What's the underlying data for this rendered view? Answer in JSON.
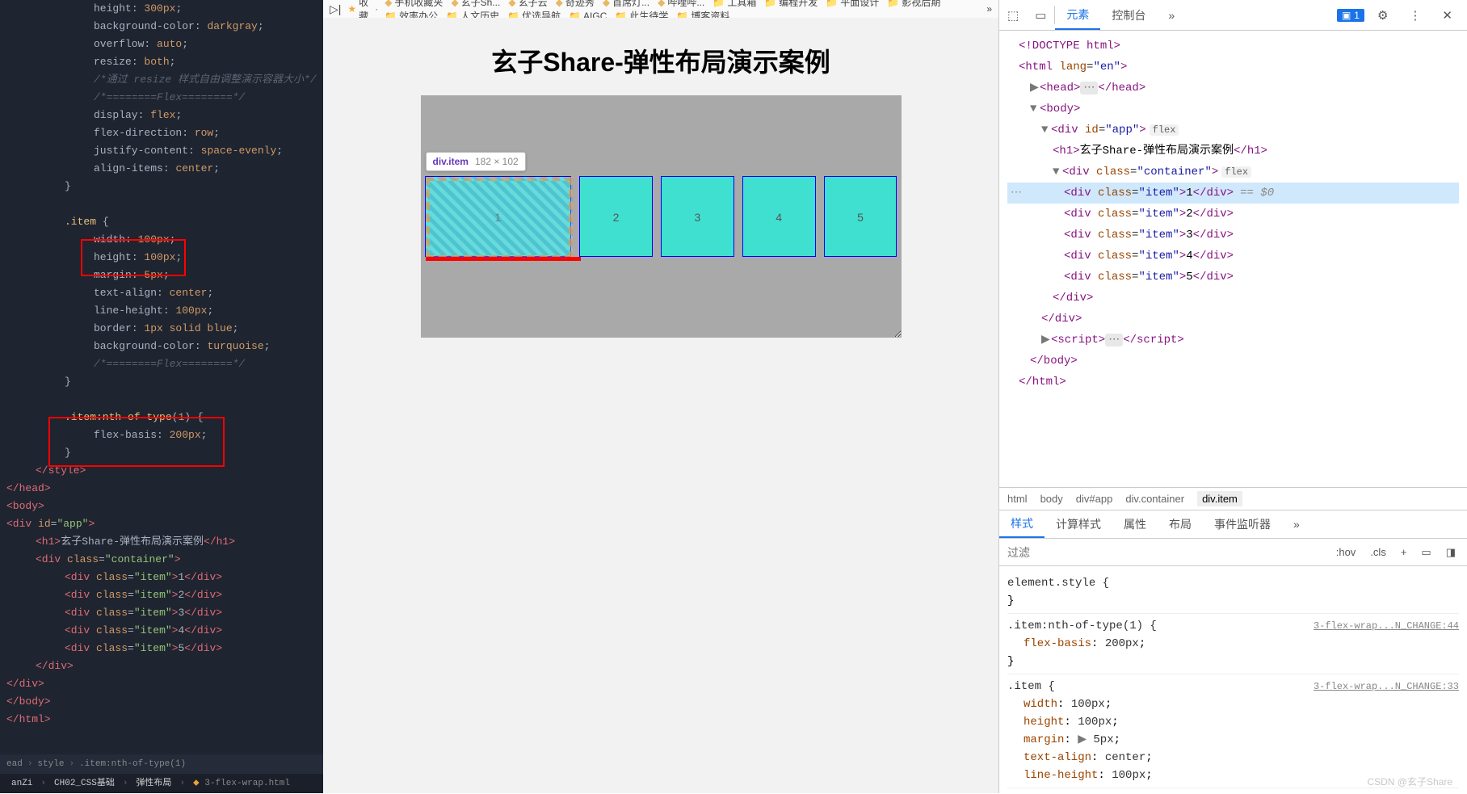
{
  "editor": {
    "lines": [
      {
        "cls": "indent3",
        "html": "<span class='tok-prop'>height</span><span class='tok-punc'>: </span><span class='tok-val'>300px</span><span class='tok-punc'>;</span>"
      },
      {
        "cls": "indent3",
        "html": "<span class='tok-prop'>background-color</span><span class='tok-punc'>: </span><span class='tok-val'>darkgray</span><span class='tok-punc'>;</span>"
      },
      {
        "cls": "indent3",
        "html": "<span class='tok-prop'>overflow</span><span class='tok-punc'>: </span><span class='tok-val'>auto</span><span class='tok-punc'>;</span>"
      },
      {
        "cls": "indent3",
        "html": "<span class='tok-prop'>resize</span><span class='tok-punc'>: </span><span class='tok-val'>both</span><span class='tok-punc'>;</span>"
      },
      {
        "cls": "indent3",
        "html": "<span class='tok-comment'>/*通过 resize 样式自由调整演示容器大小*/</span>"
      },
      {
        "cls": "indent3",
        "html": "<span class='tok-comment'>/*========Flex========*/</span>"
      },
      {
        "cls": "indent3",
        "html": "<span class='tok-prop'>display</span><span class='tok-punc'>: </span><span class='tok-val'>flex</span><span class='tok-punc'>;</span>"
      },
      {
        "cls": "indent3",
        "html": "<span class='tok-prop'>flex-direction</span><span class='tok-punc'>: </span><span class='tok-val'>row</span><span class='tok-punc'>;</span>"
      },
      {
        "cls": "indent3",
        "html": "<span class='tok-prop'>justify-content</span><span class='tok-punc'>: </span><span class='tok-val'>space-evenly</span><span class='tok-punc'>;</span>"
      },
      {
        "cls": "indent3",
        "html": "<span class='tok-prop'>align-items</span><span class='tok-punc'>: </span><span class='tok-val'>center</span><span class='tok-punc'>;</span>"
      },
      {
        "cls": "indent2",
        "html": "<span class='tok-punc'>}</span>"
      },
      {
        "cls": "indent2",
        "html": " "
      },
      {
        "cls": "indent2",
        "html": "<span class='tok-sel'>.item</span> <span class='tok-punc'>{</span>"
      },
      {
        "cls": "indent3",
        "html": "<span class='tok-prop'>width</span><span class='tok-punc'>: </span><span class='tok-val'>100px</span><span class='tok-punc'>;</span>"
      },
      {
        "cls": "indent3",
        "html": "<span class='tok-prop'>height</span><span class='tok-punc'>: </span><span class='tok-val'>100px</span><span class='tok-punc'>;</span>"
      },
      {
        "cls": "indent3",
        "html": "<span class='tok-prop'>margin</span><span class='tok-punc'>: </span><span class='tok-val'>5px</span><span class='tok-punc'>;</span>"
      },
      {
        "cls": "indent3",
        "html": "<span class='tok-prop'>text-align</span><span class='tok-punc'>: </span><span class='tok-val'>center</span><span class='tok-punc'>;</span>"
      },
      {
        "cls": "indent3",
        "html": "<span class='tok-prop'>line-height</span><span class='tok-punc'>: </span><span class='tok-val'>100px</span><span class='tok-punc'>;</span>"
      },
      {
        "cls": "indent3",
        "html": "<span class='tok-prop'>border</span><span class='tok-punc'>: </span><span class='tok-val'>1px solid blue</span><span class='tok-punc'>;</span>"
      },
      {
        "cls": "indent3",
        "html": "<span class='tok-prop'>background-color</span><span class='tok-punc'>: </span><span class='tok-val'>turquoise</span><span class='tok-punc'>;</span>"
      },
      {
        "cls": "indent3",
        "html": "<span class='tok-comment'>/*========Flex========*/</span>"
      },
      {
        "cls": "indent2",
        "html": "<span class='tok-punc'>}</span>"
      },
      {
        "cls": "indent2",
        "html": " "
      },
      {
        "cls": "indent2",
        "html": "<span class='tok-sel'>.item:nth-of-type</span><span class='tok-punc'>(</span><span class='tok-val'>1</span><span class='tok-punc'>)</span> <span class='tok-punc'>{</span>"
      },
      {
        "cls": "indent3",
        "html": "<span class='tok-prop'>flex-basis</span><span class='tok-punc'>: </span><span class='tok-val'>200px</span><span class='tok-punc'>;</span>"
      },
      {
        "cls": "indent2",
        "html": "<span class='tok-punc'>}</span>"
      },
      {
        "cls": "indent1",
        "html": "<span class='tok-tag'>&lt;/style&gt;</span>"
      },
      {
        "cls": "",
        "html": "<span class='tok-tag'>&lt;/head&gt;</span>"
      },
      {
        "cls": "",
        "html": "<span class='tok-tag'>&lt;body&gt;</span>"
      },
      {
        "cls": "",
        "html": "<span class='tok-tag'>&lt;div</span> <span class='tok-attr'>id</span><span class='tok-punc'>=</span><span class='tok-str'>\"app\"</span><span class='tok-tag'>&gt;</span>"
      },
      {
        "cls": "indent1",
        "html": "<span class='tok-tag'>&lt;h1&gt;</span><span class='tok-white'>玄子Share-弹性布局演示案例</span><span class='tok-tag'>&lt;/h1&gt;</span>"
      },
      {
        "cls": "indent1",
        "html": "<span class='tok-tag'>&lt;div</span> <span class='tok-attr'>class</span><span class='tok-punc'>=</span><span class='tok-str'>\"container\"</span><span class='tok-tag'>&gt;</span>"
      },
      {
        "cls": "indent2",
        "html": "<span class='tok-tag'>&lt;div</span> <span class='tok-attr'>class</span><span class='tok-punc'>=</span><span class='tok-str'>\"item\"</span><span class='tok-tag'>&gt;</span><span class='tok-white'>1</span><span class='tok-tag'>&lt;/div&gt;</span>"
      },
      {
        "cls": "indent2",
        "html": "<span class='tok-tag'>&lt;div</span> <span class='tok-attr'>class</span><span class='tok-punc'>=</span><span class='tok-str'>\"item\"</span><span class='tok-tag'>&gt;</span><span class='tok-white'>2</span><span class='tok-tag'>&lt;/div&gt;</span>"
      },
      {
        "cls": "indent2",
        "html": "<span class='tok-tag'>&lt;div</span> <span class='tok-attr'>class</span><span class='tok-punc'>=</span><span class='tok-str'>\"item\"</span><span class='tok-tag'>&gt;</span><span class='tok-white'>3</span><span class='tok-tag'>&lt;/div&gt;</span>"
      },
      {
        "cls": "indent2",
        "html": "<span class='tok-tag'>&lt;div</span> <span class='tok-attr'>class</span><span class='tok-punc'>=</span><span class='tok-str'>\"item\"</span><span class='tok-tag'>&gt;</span><span class='tok-white'>4</span><span class='tok-tag'>&lt;/div&gt;</span>"
      },
      {
        "cls": "indent2",
        "html": "<span class='tok-tag'>&lt;div</span> <span class='tok-attr'>class</span><span class='tok-punc'>=</span><span class='tok-str'>\"item\"</span><span class='tok-tag'>&gt;</span><span class='tok-white'>5</span><span class='tok-tag'>&lt;/div&gt;</span>"
      },
      {
        "cls": "indent1",
        "html": "<span class='tok-tag'>&lt;/div&gt;</span>"
      },
      {
        "cls": "",
        "html": "<span class='tok-tag'>&lt;/div&gt;</span>"
      },
      {
        "cls": "",
        "html": "<span class='tok-tag'>&lt;/body&gt;</span>"
      },
      {
        "cls": "",
        "html": "<span class='tok-tag'>&lt;/html&gt;</span>"
      }
    ],
    "breadcrumb": [
      "ead",
      "style",
      ".item:nth-of-type(1)"
    ],
    "bottom": {
      "p1": "anZi",
      "p2": "CH02_CSS基础",
      "p3": "弹性布局",
      "file": "3-flex-wrap.html"
    }
  },
  "bookmarks": {
    "fav": "收藏",
    "items": [
      "手机收藏夹",
      "玄子Sh...",
      "玄子云",
      "奇迹秀",
      "首席灯...",
      "哔哩哔...",
      "工具箱",
      "编程开发",
      "平面设计",
      "影视后期",
      "效率办公",
      "人文历史",
      "优选导航",
      "AIGC",
      "此生待学",
      "博客资料"
    ]
  },
  "preview": {
    "title": "玄子Share-弹性布局演示案例",
    "items": [
      "1",
      "2",
      "3",
      "4",
      "5"
    ],
    "tooltip": {
      "selector": "div.item",
      "dims": "182 × 102"
    }
  },
  "devtools": {
    "tabs": {
      "elements": "元素",
      "console": "控制台"
    },
    "badge": "1",
    "elements_tree": {
      "doctype": "<!DOCTYPE html>",
      "html_open": "html",
      "lang": "en",
      "head": "head",
      "body": "body",
      "app": {
        "tag": "div",
        "id": "app",
        "badge": "flex"
      },
      "h1": "玄子Share-弹性布局演示案例",
      "container": {
        "tag": "div",
        "cls": "container",
        "badge": "flex"
      },
      "items": [
        "1",
        "2",
        "3",
        "4",
        "5"
      ],
      "selmark": "== $0",
      "script": "script"
    },
    "crumbs": [
      "html",
      "body",
      "div#app",
      "div.container",
      "div.item"
    ],
    "style_tabs": [
      "样式",
      "计算样式",
      "属性",
      "布局",
      "事件监听器"
    ],
    "filter_placeholder": "过滤",
    "filter_buttons": [
      ":hov",
      ".cls",
      "+"
    ],
    "styles": [
      {
        "selector": "element.style {",
        "props": [],
        "close": "}"
      },
      {
        "selector": ".item:nth-of-type(1) {",
        "source": "3-flex-wrap...N_CHANGE:44",
        "props": [
          {
            "n": "flex-basis",
            "v": "200px"
          }
        ],
        "close": "}"
      },
      {
        "selector": ".item {",
        "source": "3-flex-wrap...N_CHANGE:33",
        "props": [
          {
            "n": "width",
            "v": "100px"
          },
          {
            "n": "height",
            "v": "100px"
          },
          {
            "n": "margin",
            "v": "5px",
            "arrow": true
          },
          {
            "n": "text-align",
            "v": "center"
          },
          {
            "n": "line-height",
            "v": "100px"
          }
        ]
      }
    ]
  },
  "watermark": "CSDN @玄子Share"
}
